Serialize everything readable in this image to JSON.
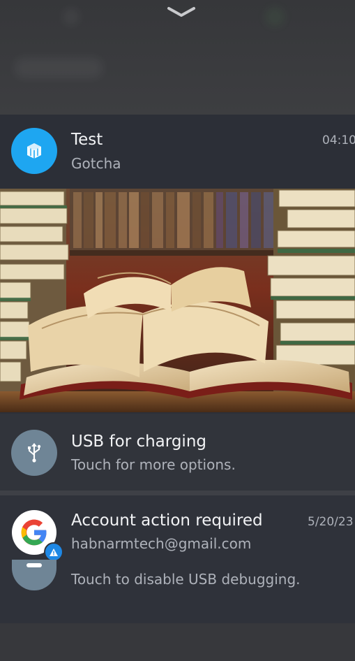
{
  "colors": {
    "test_icon_bg": "#1ea6f1",
    "usb_icon_bg": "#6f8596",
    "card_bg": "#2c2f37",
    "warning_badge": "#1e88e5"
  },
  "notifications": [
    {
      "app_icon": "cube-app-icon",
      "title": "Test",
      "text": "Gotcha",
      "time": "04:10",
      "has_big_picture": true,
      "big_picture": "books-image"
    },
    {
      "app_icon": "usb-icon",
      "title": "USB for charging",
      "text": "Touch for more options."
    },
    {
      "app_icon": "google-logo-icon",
      "badge_icon": "warning-badge-icon",
      "title": "Account action required",
      "text": "habnarmtech@gmail.com",
      "time": "5/20/23"
    },
    {
      "app_icon": "usb-debug-icon",
      "text": "Touch to disable USB debugging."
    }
  ]
}
